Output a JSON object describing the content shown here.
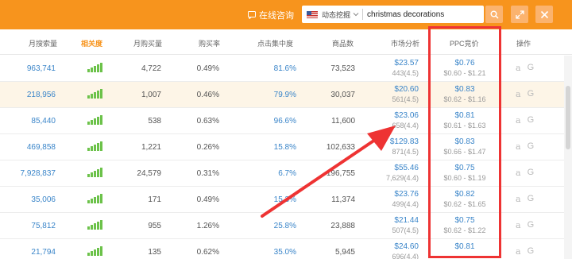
{
  "toolbar": {
    "consult_label": "在线咨询",
    "market_label": "动态挖掘",
    "keyword": "christmas decorations"
  },
  "columns": [
    "月搜索量",
    "相关度",
    "月购买量",
    "购买率",
    "点击集中度",
    "商品数",
    "市场分析",
    "PPC竞价",
    "操作"
  ],
  "active_column": "相关度",
  "rows": [
    {
      "monthly_search": "963,741",
      "relevance_level": 5,
      "monthly_purchase": "4,722",
      "purchase_rate": "0.49%",
      "click_concentration": "81.6%",
      "product_count": "73,523",
      "market_price": "$23.57",
      "market_rating": "443(4.5)",
      "ppc_price": "$0.76",
      "ppc_range": "$0.60 - $1.21"
    },
    {
      "monthly_search": "218,956",
      "relevance_level": 5,
      "monthly_purchase": "1,007",
      "purchase_rate": "0.46%",
      "click_concentration": "79.9%",
      "product_count": "30,037",
      "market_price": "$20.60",
      "market_rating": "561(4.5)",
      "ppc_price": "$0.83",
      "ppc_range": "$0.62 - $1.16"
    },
    {
      "monthly_search": "85,440",
      "relevance_level": 5,
      "monthly_purchase": "538",
      "purchase_rate": "0.63%",
      "click_concentration": "96.6%",
      "product_count": "11,600",
      "market_price": "$23.06",
      "market_rating": "658(4.4)",
      "ppc_price": "$0.81",
      "ppc_range": "$0.61 - $1.63"
    },
    {
      "monthly_search": "469,858",
      "relevance_level": 5,
      "monthly_purchase": "1,221",
      "purchase_rate": "0.26%",
      "click_concentration": "15.8%",
      "product_count": "102,633",
      "market_price": "$129.83",
      "market_rating": "871(4.5)",
      "ppc_price": "$0.83",
      "ppc_range": "$0.66 - $1.47"
    },
    {
      "monthly_search": "7,928,837",
      "relevance_level": 5,
      "monthly_purchase": "24,579",
      "purchase_rate": "0.31%",
      "click_concentration": "6.7%",
      "product_count": "196,755",
      "market_price": "$55.46",
      "market_rating": "7,629(4.4)",
      "ppc_price": "$0.75",
      "ppc_range": "$0.60 - $1.19"
    },
    {
      "monthly_search": "35,006",
      "relevance_level": 5,
      "monthly_purchase": "171",
      "purchase_rate": "0.49%",
      "click_concentration": "15.3%",
      "product_count": "11,374",
      "market_price": "$23.76",
      "market_rating": "499(4.4)",
      "ppc_price": "$0.82",
      "ppc_range": "$0.62 - $1.65"
    },
    {
      "monthly_search": "75,812",
      "relevance_level": 5,
      "monthly_purchase": "955",
      "purchase_rate": "1.26%",
      "click_concentration": "25.8%",
      "product_count": "23,888",
      "market_price": "$21.44",
      "market_rating": "507(4.5)",
      "ppc_price": "$0.75",
      "ppc_range": "$0.62 - $1.22"
    },
    {
      "monthly_search": "21,794",
      "relevance_level": 5,
      "monthly_purchase": "135",
      "purchase_rate": "0.62%",
      "click_concentration": "35.0%",
      "product_count": "5,945",
      "market_price": "$24.60",
      "market_rating": "696(4.4)",
      "ppc_price": "$0.81",
      "ppc_range": ""
    }
  ],
  "operation_icons": [
    "amazon-icon",
    "google-icon"
  ],
  "colors": {
    "topbar": "#f7941d",
    "active_header": "#f7941d",
    "link": "#3a85c9",
    "relevance": "#6cc24a",
    "highlight_box": "#ee3333",
    "row_highlight": "#fdf5e7"
  }
}
